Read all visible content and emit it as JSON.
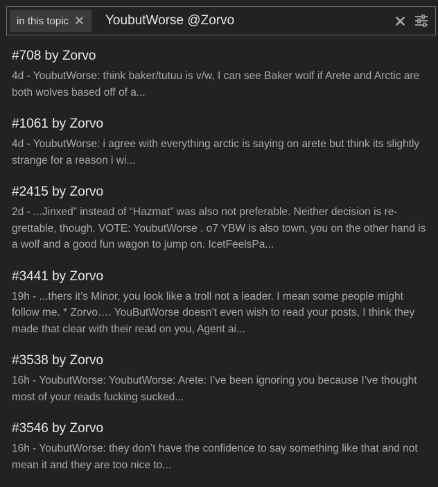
{
  "search": {
    "context_label": "in this topic",
    "query": "YoubutWorse @Zorvo",
    "chip_close_icon": "close-icon",
    "clear_icon": "close-icon",
    "options_icon": "sliders-icon"
  },
  "results": [
    {
      "title": "#708 by Zorvo",
      "blurb": "4d - YoubutWorse: think baker/tutuu is v/w, I can see Baker wolf if Arete and Arctic are both wolves based off of a..."
    },
    {
      "title": "#1061 by Zorvo",
      "blurb": "4d - YoubutWorse: i agree with everything arctic is saying on arete but think its slightly strange for a reason i wi..."
    },
    {
      "title": "#2415 by Zorvo",
      "blurb": "2d - ...Jinxed” instead of “Hazmat” was also not preferable. Neither decision is re-grettable, though. VOTE: YoubutWorse . o7 YBW is also town, you on the other hand is a wolf and a good fun wagon to jump on. IcetFeelsPa..."
    },
    {
      "title": "#3441 by Zorvo",
      "blurb": "19h - ...thers it’s Minor, you look like a troll not a leader. I mean some people might follow me. * Zorvo…. YouButWorse doesn’t even wish to read your posts, I think they made that clear with their read on you, Agent ai..."
    },
    {
      "title": "#3538 by Zorvo",
      "blurb": "16h - YoubutWorse: YoubutWorse: Arete: I’ve been ignoring you because I’ve thought most of your reads fucking sucked..."
    },
    {
      "title": "#3546 by Zorvo",
      "blurb": "16h - YoubutWorse: they don’t have the confidence to say something like that and not mean it and they are too nice to..."
    }
  ]
}
